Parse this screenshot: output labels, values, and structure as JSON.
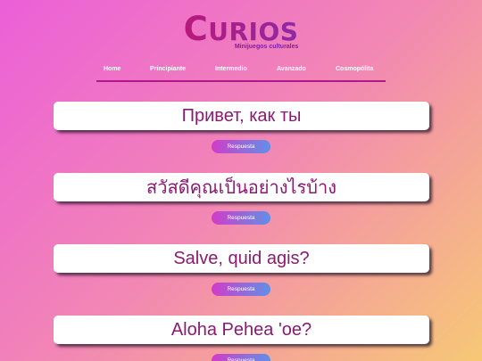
{
  "brand": {
    "initial": "C",
    "title_rest": "URIOS",
    "subtitle": "Minijuegos culturales"
  },
  "nav": {
    "items": [
      {
        "label": "Home"
      },
      {
        "label": "Principiante"
      },
      {
        "label": "Intermedio"
      },
      {
        "label": "Avanzado"
      },
      {
        "label": "Cosmopólita"
      }
    ]
  },
  "cards": [
    {
      "phrase": "Привет, как ты",
      "button": "Respuesta"
    },
    {
      "phrase": "สวัสดีคุณเป็นอย่างไรบ้าง",
      "button": "Respuesta"
    },
    {
      "phrase": "Salve, quid agis?",
      "button": "Respuesta"
    },
    {
      "phrase": "Aloha Pehea 'oe?",
      "button": "Respuesta"
    }
  ]
}
